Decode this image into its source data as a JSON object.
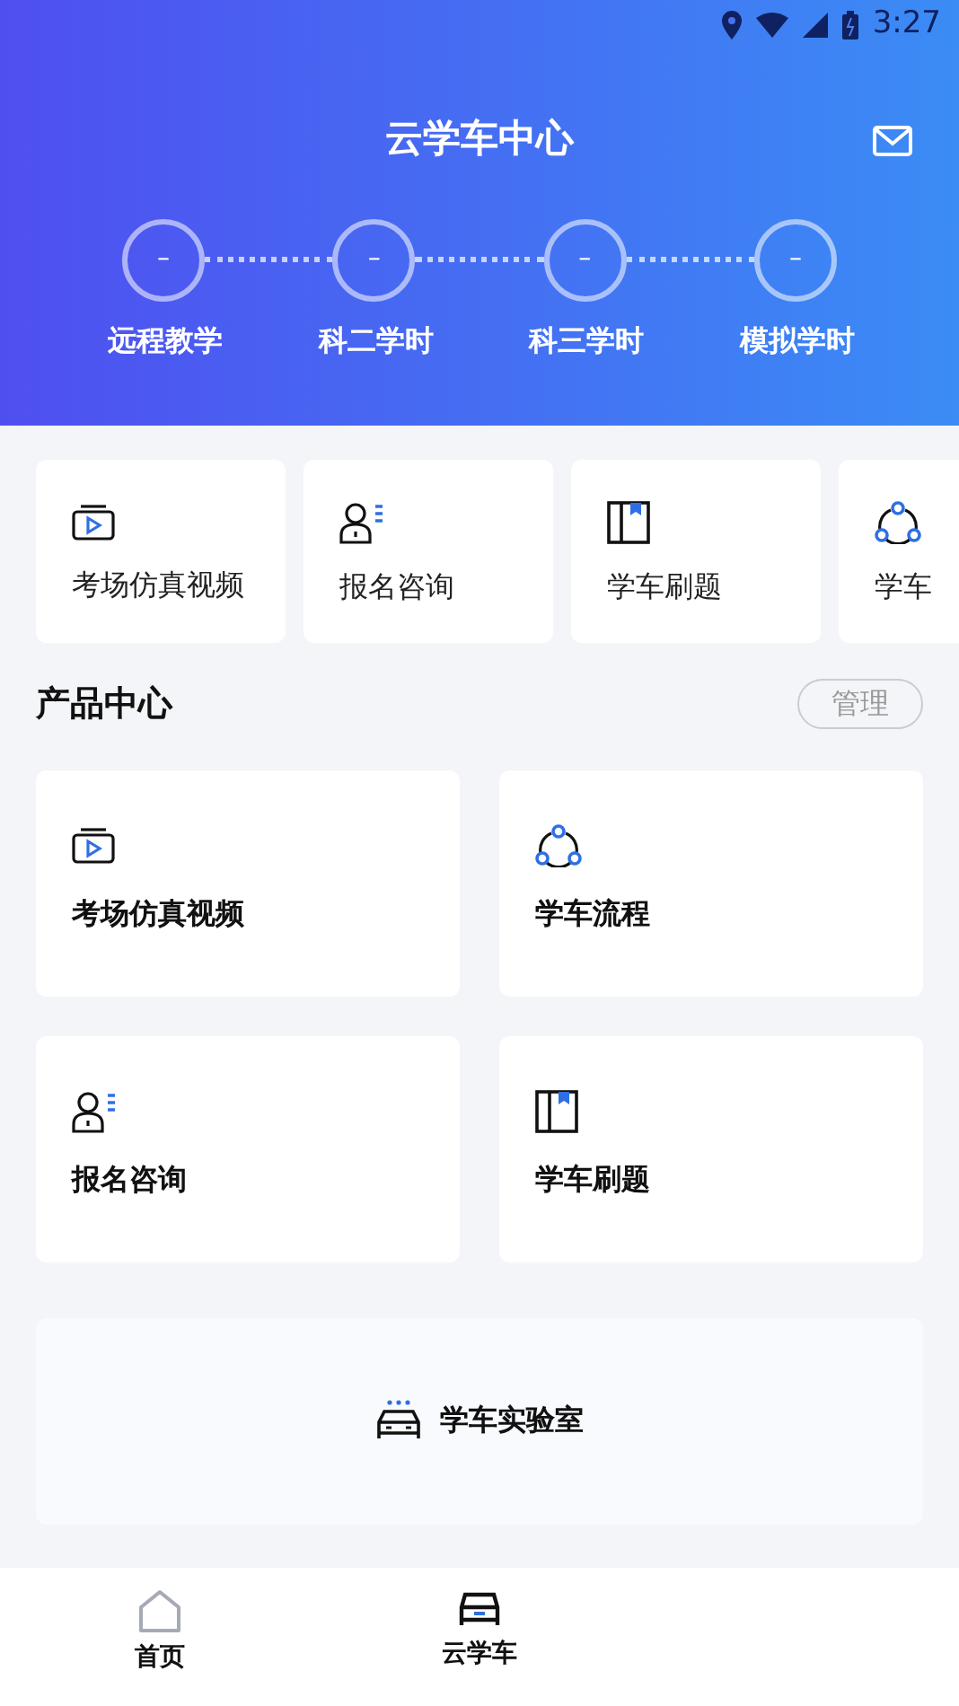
{
  "status_bar": {
    "time": "3:27"
  },
  "header": {
    "title": "云学车中心"
  },
  "progress_steps": [
    {
      "value": "–",
      "label": "远程教学"
    },
    {
      "value": "–",
      "label": "科二学时"
    },
    {
      "value": "–",
      "label": "科三学时"
    },
    {
      "value": "–",
      "label": "模拟学时"
    }
  ],
  "quick_links": [
    {
      "label": "考场仿真视频"
    },
    {
      "label": "报名咨询"
    },
    {
      "label": "学车刷题"
    },
    {
      "label": "学车"
    }
  ],
  "product_center": {
    "title": "产品中心",
    "manage_button": "管理",
    "cards": [
      {
        "label": "考场仿真视频"
      },
      {
        "label": "学车流程"
      },
      {
        "label": "报名咨询"
      },
      {
        "label": "学车刷题"
      }
    ],
    "lab_card": {
      "label": "学车实验室"
    }
  },
  "bottom_nav": [
    {
      "label": "首页",
      "selected": false
    },
    {
      "label": "云学车",
      "selected": true
    }
  ]
}
